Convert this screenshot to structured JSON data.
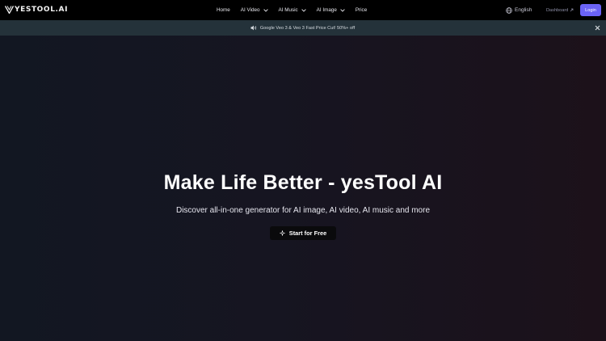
{
  "brand": {
    "name": "yesTool.ai",
    "logo_text": "YESTOOL.AI"
  },
  "nav": {
    "items": [
      {
        "label": "Home",
        "has_dropdown": false
      },
      {
        "label": "AI Video",
        "has_dropdown": true
      },
      {
        "label": "AI Music",
        "has_dropdown": true
      },
      {
        "label": "AI Image",
        "has_dropdown": true
      },
      {
        "label": "Price",
        "has_dropdown": false
      }
    ],
    "language": "English",
    "dashboard_label": "Dashboard",
    "login_label": "Login"
  },
  "banner": {
    "icon": "speaker-icon",
    "text": "Google Veo 3 & Veo 3 Fast Price Cut! 50%+ off",
    "close_icon": "close-icon"
  },
  "hero": {
    "title": "Make Life Better - yesTool AI",
    "subtitle": "Discover all-in-one generator for AI image, AI video, AI music and more",
    "cta_label": "Start for Free",
    "cta_icon": "sparkle-icon"
  },
  "colors": {
    "navbar_bg": "#000000",
    "banner_bg": "#24323a",
    "login_accent": "#6b63f6",
    "hero_bg_left": "#121722",
    "hero_bg_right": "#1c111a",
    "cta_bg": "#0a0a0c"
  }
}
